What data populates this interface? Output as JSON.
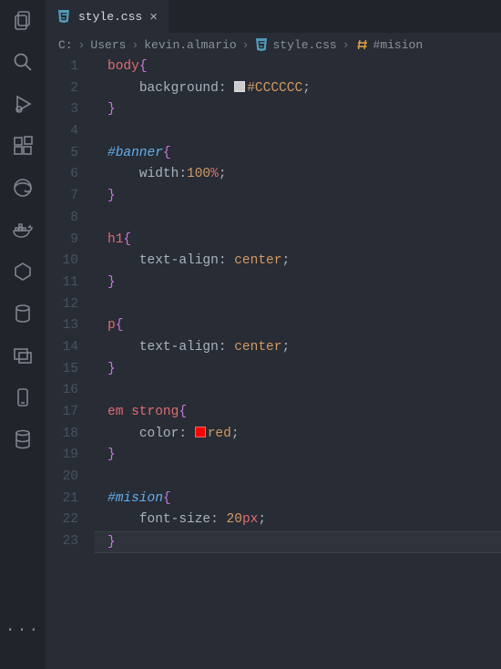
{
  "activityBar": {
    "items": [
      {
        "name": "explorer-icon"
      },
      {
        "name": "search-icon"
      },
      {
        "name": "run-debug-icon"
      },
      {
        "name": "extensions-icon"
      },
      {
        "name": "edge-icon"
      },
      {
        "name": "docker-icon"
      },
      {
        "name": "hexagon-icon"
      },
      {
        "name": "database-icon"
      },
      {
        "name": "windows-icon"
      },
      {
        "name": "device-icon"
      },
      {
        "name": "database2-icon"
      }
    ],
    "more": "···"
  },
  "tab": {
    "filename": "style.css",
    "close": "×"
  },
  "breadcrumbs": {
    "parts": [
      "C:",
      "Users",
      "kevin.almario"
    ],
    "file": "style.css",
    "symbol": "#mision",
    "sep": "›"
  },
  "code": {
    "lines": [
      {
        "n": "1",
        "seg": [
          {
            "t": "body",
            "c": "tok-seltag"
          },
          {
            "t": "{",
            "c": "tok-brace"
          }
        ]
      },
      {
        "n": "2",
        "indent": 1,
        "seg": [
          {
            "t": "background",
            "c": "tok-prop"
          },
          {
            "t": ": ",
            "c": "tok-punc"
          },
          {
            "swatch": "#CCCCCC"
          },
          {
            "t": "#CCCCCC",
            "c": "tok-val"
          },
          {
            "t": ";",
            "c": "tok-punc"
          }
        ]
      },
      {
        "n": "3",
        "seg": [
          {
            "t": "}",
            "c": "tok-brace"
          }
        ]
      },
      {
        "n": "4",
        "seg": []
      },
      {
        "n": "5",
        "seg": [
          {
            "t": "#banner",
            "c": "tok-id"
          },
          {
            "t": "{",
            "c": "tok-brace"
          }
        ]
      },
      {
        "n": "6",
        "indent": 1,
        "seg": [
          {
            "t": "width",
            "c": "tok-prop"
          },
          {
            "t": ":",
            "c": "tok-punc"
          },
          {
            "t": "100",
            "c": "tok-num"
          },
          {
            "t": "%",
            "c": "tok-unit"
          },
          {
            "t": ";",
            "c": "tok-punc"
          }
        ]
      },
      {
        "n": "7",
        "seg": [
          {
            "t": "}",
            "c": "tok-brace"
          }
        ]
      },
      {
        "n": "8",
        "seg": []
      },
      {
        "n": "9",
        "seg": [
          {
            "t": "h1",
            "c": "tok-seltag"
          },
          {
            "t": "{",
            "c": "tok-brace"
          }
        ]
      },
      {
        "n": "10",
        "indent": 1,
        "seg": [
          {
            "t": "text-align",
            "c": "tok-prop"
          },
          {
            "t": ": ",
            "c": "tok-punc"
          },
          {
            "t": "center",
            "c": "tok-val"
          },
          {
            "t": ";",
            "c": "tok-punc"
          }
        ]
      },
      {
        "n": "11",
        "seg": [
          {
            "t": "}",
            "c": "tok-brace"
          }
        ]
      },
      {
        "n": "12",
        "seg": []
      },
      {
        "n": "13",
        "seg": [
          {
            "t": "p",
            "c": "tok-seltag"
          },
          {
            "t": "{",
            "c": "tok-brace"
          }
        ]
      },
      {
        "n": "14",
        "indent": 1,
        "seg": [
          {
            "t": "text-align",
            "c": "tok-prop"
          },
          {
            "t": ": ",
            "c": "tok-punc"
          },
          {
            "t": "center",
            "c": "tok-val"
          },
          {
            "t": ";",
            "c": "tok-punc"
          }
        ]
      },
      {
        "n": "15",
        "seg": [
          {
            "t": "}",
            "c": "tok-brace"
          }
        ]
      },
      {
        "n": "16",
        "seg": []
      },
      {
        "n": "17",
        "seg": [
          {
            "t": "em ",
            "c": "tok-seltag"
          },
          {
            "t": "strong",
            "c": "tok-seltag"
          },
          {
            "t": "{",
            "c": "tok-brace"
          }
        ]
      },
      {
        "n": "18",
        "indent": 1,
        "seg": [
          {
            "t": "color",
            "c": "tok-prop"
          },
          {
            "t": ": ",
            "c": "tok-punc"
          },
          {
            "swatch": "#ff0000"
          },
          {
            "t": "red",
            "c": "tok-val"
          },
          {
            "t": ";",
            "c": "tok-punc"
          }
        ]
      },
      {
        "n": "19",
        "seg": [
          {
            "t": "}",
            "c": "tok-brace"
          }
        ]
      },
      {
        "n": "20",
        "seg": []
      },
      {
        "n": "21",
        "seg": [
          {
            "t": "#mision",
            "c": "tok-id"
          },
          {
            "t": "{",
            "c": "tok-brace"
          }
        ]
      },
      {
        "n": "22",
        "indent": 1,
        "seg": [
          {
            "t": "font-size",
            "c": "tok-prop"
          },
          {
            "t": ": ",
            "c": "tok-punc"
          },
          {
            "t": "20",
            "c": "tok-num"
          },
          {
            "t": "px",
            "c": "tok-unit"
          },
          {
            "t": ";",
            "c": "tok-punc"
          }
        ]
      },
      {
        "n": "23",
        "hl": true,
        "seg": [
          {
            "t": "}",
            "c": "tok-brace"
          }
        ]
      }
    ]
  },
  "icons": {
    "cssFile": "css-file-icon",
    "symbol": "symbol-id-icon"
  }
}
